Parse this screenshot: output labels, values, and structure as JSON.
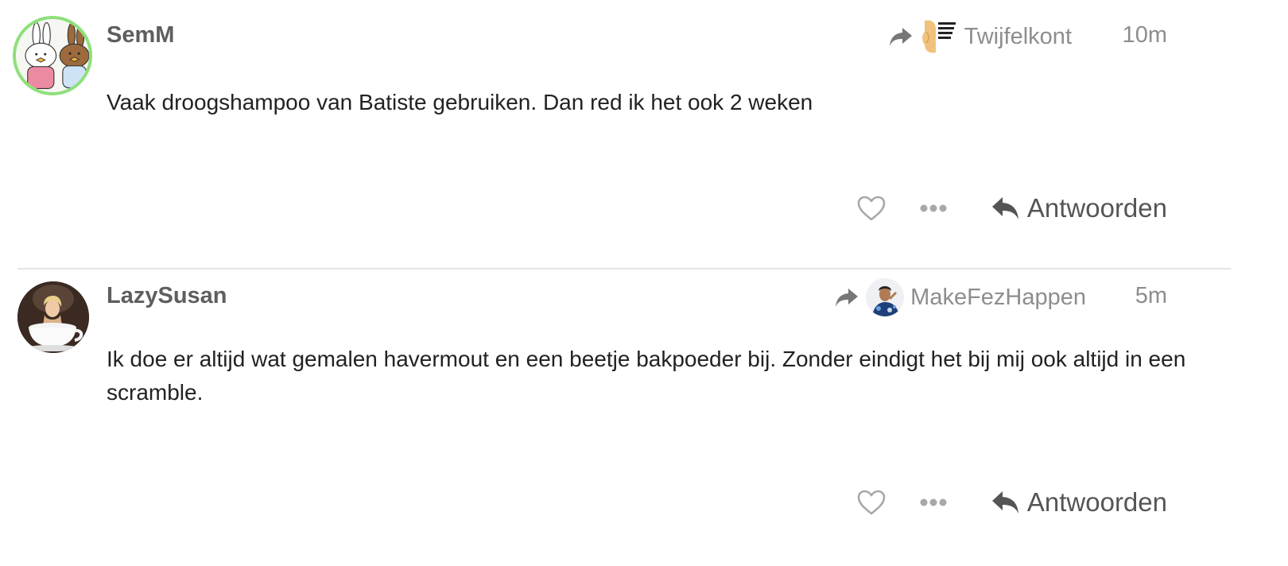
{
  "posts": [
    {
      "username": "SemM",
      "reply_to": {
        "username": "Twijfelkont",
        "avatar_text": "Zal ik het nou wel of niet doen."
      },
      "timestamp": "10m",
      "body": "Vaak droogshampoo van Batiste gebruiken. Dan red ik het ook 2 weken",
      "reply_label": "Antwoorden"
    },
    {
      "username": "LazySusan",
      "reply_to": {
        "username": "MakeFezHappen"
      },
      "timestamp": "5m",
      "body": "Ik doe er altijd wat gemalen havermout en een beetje bakpoeder bij. Zonder eindigt het bij mij ook altijd in een scramble.",
      "reply_label": "Antwoorden"
    }
  ],
  "colors": {
    "avatar_ring": "#8de07a",
    "muted_text": "#8d8d8d",
    "username_text": "#5e5e5e",
    "body_text": "#222222",
    "divider": "#e4e4e4"
  },
  "icons": {
    "reply_to_arrow": "share-arrow-icon",
    "like": "heart-outline-icon",
    "more": "ellipsis-icon",
    "reply": "reply-arrow-icon"
  }
}
